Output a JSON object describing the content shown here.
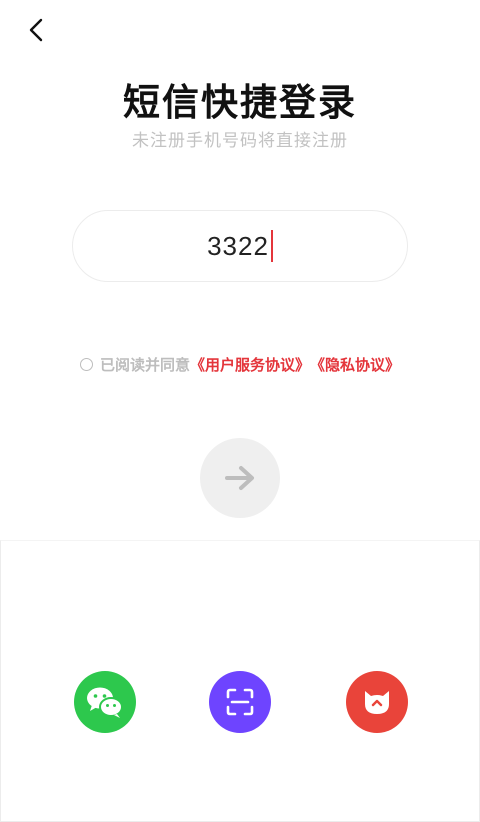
{
  "header": {
    "title": "短信快捷登录",
    "subtitle": "未注册手机号码将直接注册"
  },
  "phone_input": {
    "value": "3322"
  },
  "agreement": {
    "prefix": "已阅读并同意",
    "user_agreement": "《用户服务协议》",
    "privacy_policy": "《隐私协议》",
    "checked": false
  },
  "colors": {
    "accent": "#e4353b",
    "wechat": "#2dc84d",
    "scan": "#6e44ff",
    "cat": "#e9443a",
    "muted_text": "#c2c2c2",
    "submit_bg": "#efefef"
  },
  "social_login": [
    {
      "icon": "wechat-icon"
    },
    {
      "icon": "scan-icon"
    },
    {
      "icon": "cat-icon"
    }
  ]
}
